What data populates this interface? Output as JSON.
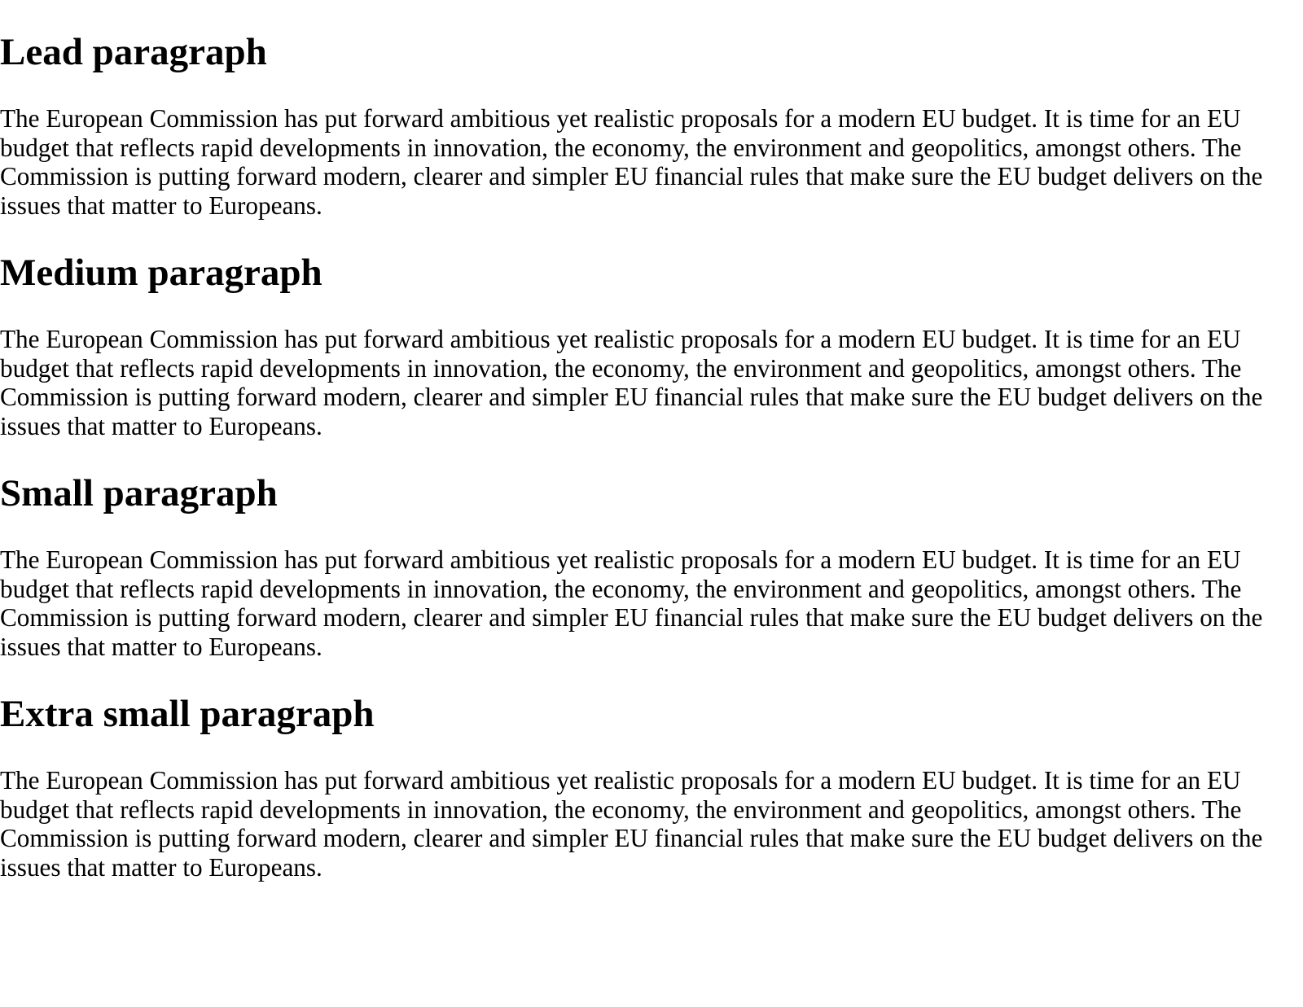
{
  "sections": [
    {
      "title": "Lead paragraph",
      "text": "The European Commission has put forward ambitious yet realistic proposals for a modern EU budget. It is time for an EU budget that reflects rapid developments in innovation, the economy, the environment and geopolitics, amongst others. The Commission is putting forward modern, clearer and simpler EU financial rules that make sure the EU budget delivers on the issues that matter to Europeans."
    },
    {
      "title": "Medium paragraph",
      "text": "The European Commission has put forward ambitious yet realistic proposals for a modern EU budget. It is time for an EU budget that reflects rapid developments in innovation, the economy, the environment and geopolitics, amongst others. The Commission is putting forward modern, clearer and simpler EU financial rules that make sure the EU budget delivers on the issues that matter to Europeans."
    },
    {
      "title": "Small paragraph",
      "text": "The European Commission has put forward ambitious yet realistic proposals for a modern EU budget. It is time for an EU budget that reflects rapid developments in innovation, the economy, the environment and geopolitics, amongst others. The Commission is putting forward modern, clearer and simpler EU financial rules that make sure the EU budget delivers on the issues that matter to Europeans."
    },
    {
      "title": "Extra small paragraph",
      "text": "The European Commission has put forward ambitious yet realistic proposals for a modern EU budget. It is time for an EU budget that reflects rapid developments in innovation, the economy, the environment and geopolitics, amongst others. The Commission is putting forward modern, clearer and simpler EU financial rules that make sure the EU budget delivers on the issues that matter to Europeans."
    }
  ]
}
